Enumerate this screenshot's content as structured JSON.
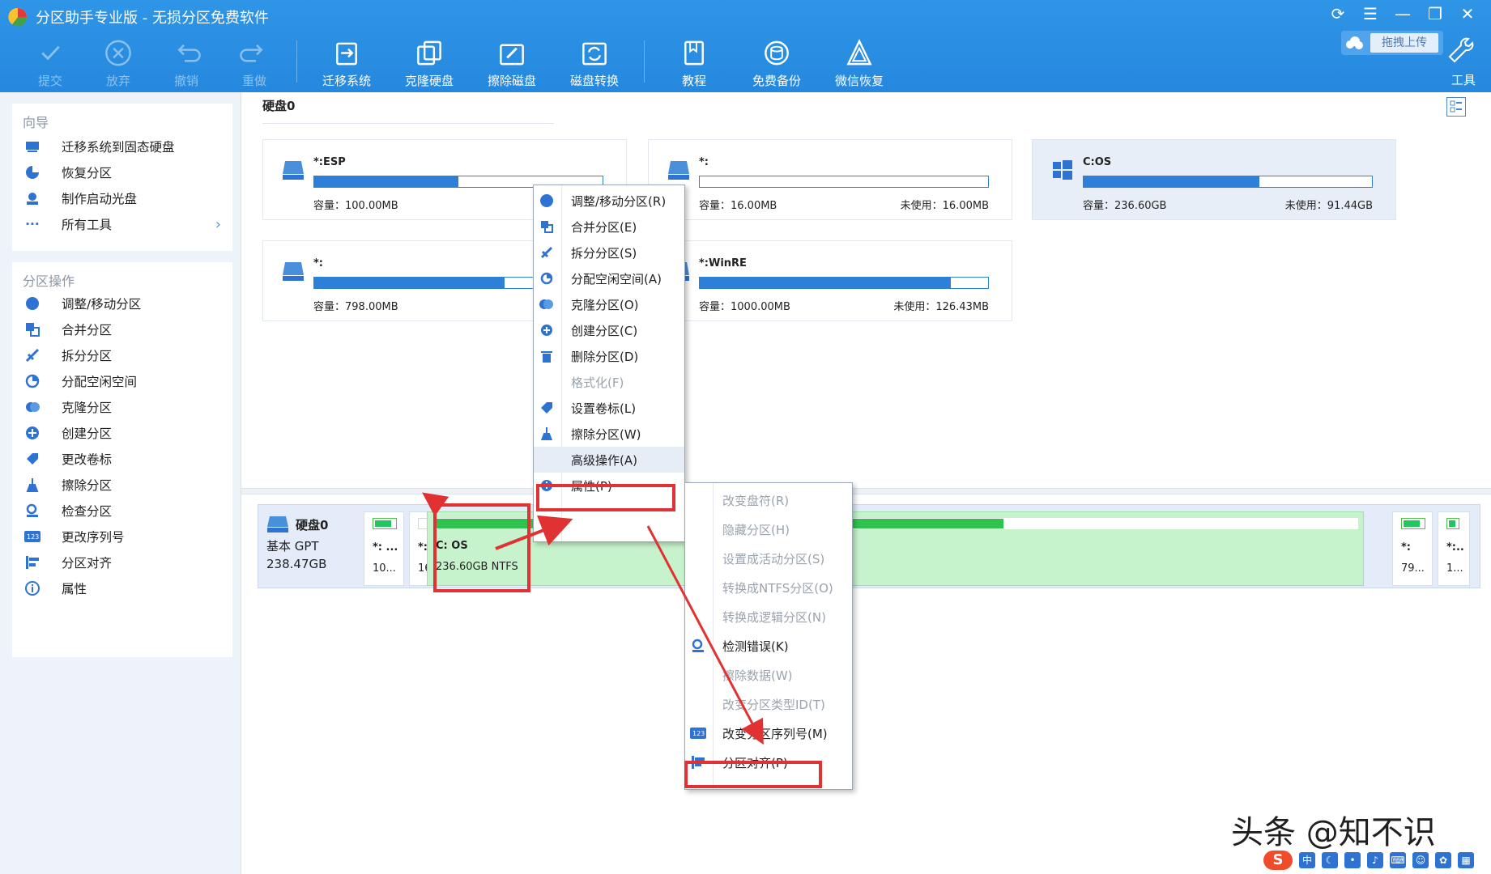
{
  "app": {
    "title": "分区助手专业版 - 无损分区免费软件"
  },
  "toolbar": {
    "submit": "提交",
    "discard": "放弃",
    "undo": "撤销",
    "redo": "重做",
    "migrate_os": "迁移系统",
    "clone_disk": "克隆硬盘",
    "wipe_disk": "擦除磁盘",
    "convert_disk": "磁盘转换",
    "tutorial": "教程",
    "free_backup": "免费备份",
    "wechat_recovery": "微信恢复",
    "tools": "工具",
    "upload_label": "拖拽上传"
  },
  "sidebar": {
    "wizard_title": "向导",
    "wizard_items": [
      "迁移系统到固态硬盘",
      "恢复分区",
      "制作启动光盘",
      "所有工具"
    ],
    "ops_title": "分区操作",
    "op_items": [
      "调整/移动分区",
      "合并分区",
      "拆分分区",
      "分配空闲空间",
      "克隆分区",
      "创建分区",
      "更改卷标",
      "擦除分区",
      "检查分区",
      "更改序列号",
      "分区对齐",
      "属性"
    ]
  },
  "disk": {
    "heading": "硬盘0",
    "name": "硬盘0",
    "type": "基本 GPT",
    "size": "238.47GB",
    "partitions": [
      {
        "name": "*:ESP",
        "capacity": "容量：100.00MB",
        "free": "未使",
        "used_fraction": 0.5
      },
      {
        "name": "*:",
        "capacity": "容量：16.00MB",
        "free": "未使用：16.00MB",
        "used_fraction": 0
      },
      {
        "name": "C:OS",
        "capacity": "容量：236.60GB",
        "free": "未使用：91.44GB",
        "used_fraction": 0.61
      },
      {
        "name": "*:",
        "capacity": "容量：798.00MB",
        "free": "未使",
        "used_fraction": 0.66
      },
      {
        "name": "*:WinRE",
        "capacity": "容量：1000.00MB",
        "free": "未使用：126.43MB",
        "used_fraction": 0.87
      }
    ],
    "map": [
      {
        "name": "*: ...",
        "size": "10..."
      },
      {
        "name": "*:",
        "size": "16..."
      },
      {
        "name": "C: OS",
        "size": "236.60GB NTFS"
      },
      {
        "name": "*:",
        "size": "79..."
      },
      {
        "name": "*:..",
        "size": "1..."
      }
    ]
  },
  "context_menu": {
    "items": [
      "调整/移动分区(R)",
      "合并分区(E)",
      "拆分分区(S)",
      "分配空闲空间(A)",
      "克隆分区(O)",
      "创建分区(C)",
      "删除分区(D)",
      "格式化(F)",
      "设置卷标(L)",
      "擦除分区(W)",
      "高级操作(A)",
      "属性(P)"
    ]
  },
  "submenu": {
    "items": [
      "改变盘符(R)",
      "隐藏分区(H)",
      "设置成活动分区(S)",
      "转换成NTFS分区(O)",
      "转换成逻辑分区(N)",
      "检测错误(K)",
      "擦除数据(W)",
      "改变分区类型ID(T)",
      "改变分区序列号(M)",
      "分区对齐(P)"
    ]
  },
  "watermark": "头条 @知不识",
  "colors": {
    "titlebar": "#2588de",
    "accent": "#2e7fd8",
    "highlight": "#e03232",
    "green": "#22c55e"
  }
}
